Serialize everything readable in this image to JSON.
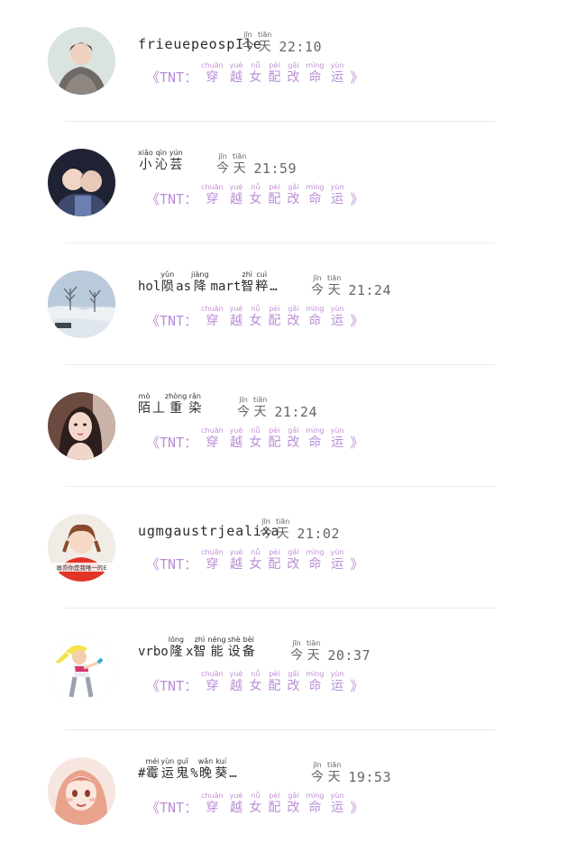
{
  "message_text": {
    "prefix": "《TNT：",
    "chars": [
      {
        "py": "chuān",
        "hz": "穿"
      },
      {
        "py": "yuè",
        "hz": "越"
      },
      {
        "py": "nǚ",
        "hz": "女"
      },
      {
        "py": "pèi",
        "hz": "配"
      },
      {
        "py": "gǎi",
        "hz": "改"
      },
      {
        "py": "mìng",
        "hz": "命"
      },
      {
        "py": "yùn",
        "hz": "运"
      }
    ],
    "suffix": "》"
  },
  "day_label": [
    {
      "py": "jīn",
      "hz": "今"
    },
    {
      "py": "tiān",
      "hz": "天"
    }
  ],
  "rows": [
    {
      "name_plain": "frieuepeospIle",
      "name_parts": [],
      "time": "22:10"
    },
    {
      "name_plain": "",
      "name_parts": [
        {
          "py": "xiǎo",
          "hz": "小"
        },
        {
          "py": "qìn",
          "hz": "沁"
        },
        {
          "py": "yún",
          "hz": "芸"
        }
      ],
      "time": "21:59"
    },
    {
      "name_plain": "",
      "name_parts": [
        {
          "t": "hol"
        },
        {
          "py": "yǔn",
          "hz": "陨"
        },
        {
          "t": "as"
        },
        {
          "py": "jiàng",
          "hz": "降"
        },
        {
          "t": "mart"
        },
        {
          "py": "zhì",
          "hz": "智"
        },
        {
          "py": "cuì",
          "hz": "粹"
        },
        {
          "t": "…"
        }
      ],
      "time": "21:24"
    },
    {
      "name_plain": "",
      "name_parts": [
        {
          "py": "mò",
          "hz": "陌"
        },
        {
          "t": "丄"
        },
        {
          "py": "zhòng",
          "hz": "重"
        },
        {
          "py": "rǎn",
          "hz": "染"
        }
      ],
      "time": "21:24"
    },
    {
      "name_plain": "ugmgaustrjealixa",
      "name_parts": [],
      "time": "21:02"
    },
    {
      "name_plain": "",
      "name_parts": [
        {
          "t": "vrbo"
        },
        {
          "py": "lóng",
          "hz": "隆"
        },
        {
          "t": "x"
        },
        {
          "py": "zhì",
          "hz": "智"
        },
        {
          "py": "néng",
          "hz": "能"
        },
        {
          "py": "shè",
          "hz": "设"
        },
        {
          "py": "bèi",
          "hz": "备"
        }
      ],
      "time": "20:37"
    },
    {
      "name_plain": "",
      "name_parts": [
        {
          "t": "#"
        },
        {
          "py": "méi",
          "hz": "霉"
        },
        {
          "py": "yùn",
          "hz": "运"
        },
        {
          "py": "guǐ",
          "hz": "鬼"
        },
        {
          "t": "%"
        },
        {
          "py": "wǎn",
          "hz": "晚"
        },
        {
          "py": "kuí",
          "hz": "葵"
        },
        {
          "t": "…"
        }
      ],
      "time": "19:53"
    }
  ],
  "avatar_icons": [
    "person-hoodie-avatar",
    "couple-avatar",
    "winter-landscape-avatar",
    "girl-portrait-avatar",
    "red-shirt-girl-avatar",
    "cartoon-girl-avatar",
    "anime-girl-avatar"
  ],
  "avatar_caption_5": "敢亦你是我唯一的E"
}
